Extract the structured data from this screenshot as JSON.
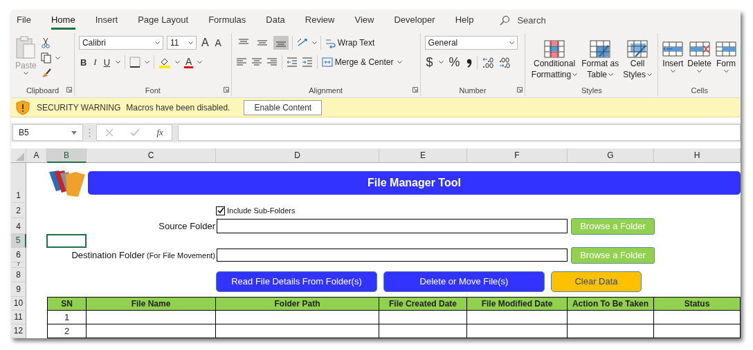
{
  "menu_tabs": [
    {
      "label": "File",
      "selected": false
    },
    {
      "label": "Home",
      "selected": true
    },
    {
      "label": "Insert",
      "selected": false
    },
    {
      "label": "Page Layout",
      "selected": false
    },
    {
      "label": "Formulas",
      "selected": false
    },
    {
      "label": "Data",
      "selected": false
    },
    {
      "label": "Review",
      "selected": false
    },
    {
      "label": "View",
      "selected": false
    },
    {
      "label": "Developer",
      "selected": false
    },
    {
      "label": "Help",
      "selected": false
    }
  ],
  "search": {
    "placeholder": "Search"
  },
  "clipboard": {
    "label": "Clipboard",
    "paste": "Paste"
  },
  "font": {
    "label": "Font",
    "font_name": "Calibri",
    "font_size": "11",
    "grow": "A",
    "shrink": "A",
    "bold": "B",
    "italic": "I",
    "underline": "U",
    "font_color": "A"
  },
  "alignment": {
    "label": "Alignment",
    "vertical_align": [
      {
        "selected": false
      },
      {
        "selected": false
      },
      {
        "selected": true
      }
    ],
    "wrap_text": "Wrap Text",
    "merge": "Merge & Center"
  },
  "number": {
    "label": "Number",
    "format": "General",
    "currency": "$",
    "percent": "%"
  },
  "styles": {
    "label": "Styles",
    "buttons": [
      {
        "kind": "conditional",
        "lines": [
          "Conditional",
          "Formatting"
        ]
      },
      {
        "kind": "table",
        "lines": [
          "Format as",
          "Table"
        ]
      },
      {
        "kind": "cell",
        "lines": [
          "Cell",
          "Styles"
        ]
      }
    ]
  },
  "cells": {
    "label": "Cells",
    "buttons": [
      {
        "kind": "insert",
        "label": "Insert"
      },
      {
        "kind": "delete",
        "label": "Delete"
      },
      {
        "kind": "format",
        "label": "Form"
      }
    ]
  },
  "security_bar": {
    "title": "SECURITY WARNING",
    "message": "Macros have been disabled.",
    "button": "Enable Content"
  },
  "formula_bar": {
    "name_box": "B5",
    "fx": "fx"
  },
  "column_headers": [
    {
      "label": "A",
      "selected": false
    },
    {
      "label": "B",
      "selected": true
    },
    {
      "label": "C",
      "selected": false
    },
    {
      "label": "D",
      "selected": false
    },
    {
      "label": "E",
      "selected": false
    },
    {
      "label": "F",
      "selected": false
    },
    {
      "label": "G",
      "selected": false
    },
    {
      "label": "H",
      "selected": false
    }
  ],
  "row_headers": [
    {
      "label": "1",
      "selected": false
    },
    {
      "label": "2",
      "selected": false
    },
    {
      "label": "4",
      "selected": false
    },
    {
      "label": "5",
      "selected": true
    },
    {
      "label": "6",
      "selected": false
    },
    {
      "label": "7",
      "selected": false
    },
    {
      "label": "8",
      "selected": false
    },
    {
      "label": "9",
      "selected": false
    },
    {
      "label": "10",
      "selected": false
    },
    {
      "label": "11",
      "selected": false
    },
    {
      "label": "12",
      "selected": false
    }
  ],
  "tool": {
    "title": "File Manager Tool",
    "include_subfolders": {
      "label": "Include Sub-Folders",
      "checked": true
    },
    "source": {
      "label": "Source Folder",
      "button": "Browse a Folder"
    },
    "destination": {
      "label": "Destination Folder",
      "note": "(For File Movement)",
      "button": "Browse a Folder"
    },
    "actions": [
      {
        "kind": "primary",
        "label": "Read File Details From Folder(s)"
      },
      {
        "kind": "primary",
        "label": "Delete or Move File(s)"
      },
      {
        "kind": "warning",
        "label": "Clear Data"
      }
    ],
    "table": {
      "columns": [
        "SN",
        "File Name",
        "Folder Path",
        "File Created Date",
        "File Modified Date",
        "Action To Be Taken",
        "Status"
      ],
      "rows": [
        {
          "sn": "1"
        },
        {
          "sn": "2"
        }
      ]
    }
  }
}
